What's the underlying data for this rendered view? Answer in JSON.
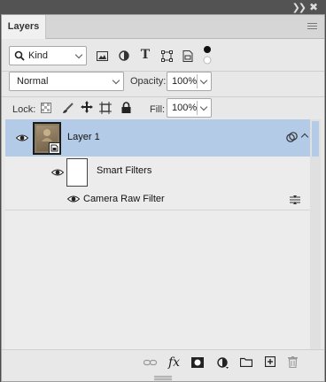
{
  "panel": {
    "tab_label": "Layers"
  },
  "filter": {
    "kind_value": "Kind"
  },
  "blend": {
    "mode_value": "Normal",
    "opacity_label": "Opacity:",
    "opacity_value": "100%",
    "lock_label": "Lock:",
    "fill_label": "Fill:",
    "fill_value": "100%"
  },
  "layers": [
    {
      "name": "Layer 1",
      "selected": true,
      "visible": true,
      "smart_filters_label": "Smart Filters",
      "filters": [
        {
          "name": "Camera Raw Filter",
          "visible": true
        }
      ]
    }
  ],
  "colors": {
    "selected_row": "#b3cbe7",
    "panel_bg": "#e8e8e8"
  }
}
